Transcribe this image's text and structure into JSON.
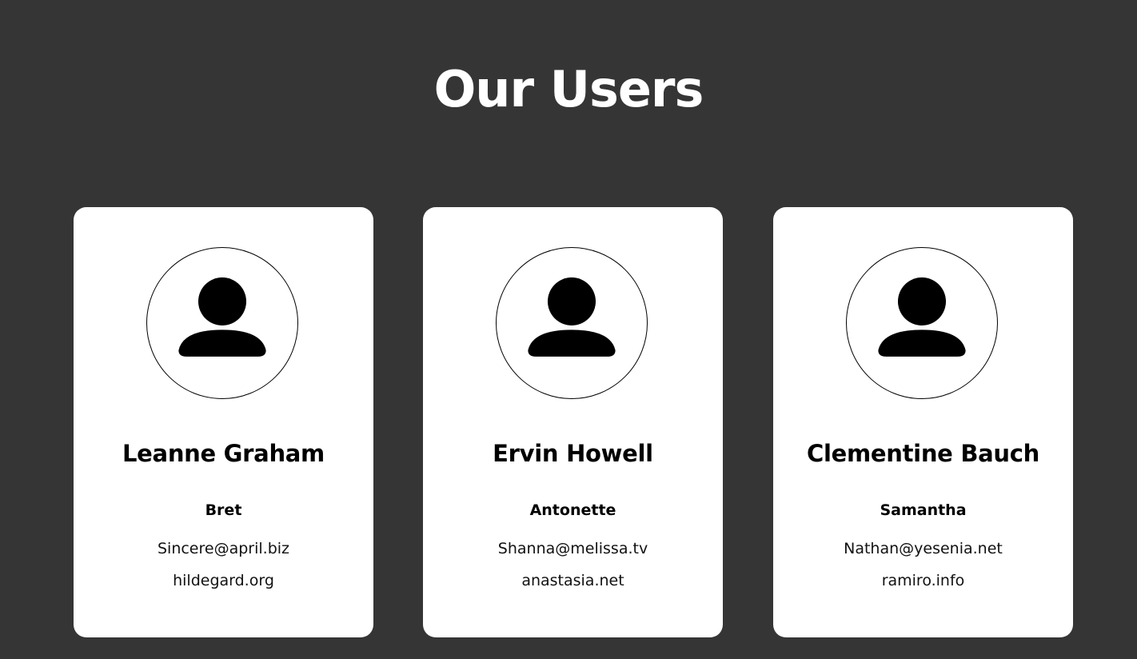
{
  "page": {
    "title": "Our Users"
  },
  "users": [
    {
      "name": "Leanne Graham",
      "username": "Bret",
      "email": "Sincere@april.biz",
      "website": "hildegard.org",
      "avatar_icon": "user-icon"
    },
    {
      "name": "Ervin Howell",
      "username": "Antonette",
      "email": "Shanna@melissa.tv",
      "website": "anastasia.net",
      "avatar_icon": "user-icon"
    },
    {
      "name": "Clementine Bauch",
      "username": "Samantha",
      "email": "Nathan@yesenia.net",
      "website": "ramiro.info",
      "avatar_icon": "user-icon"
    }
  ],
  "colors": {
    "background": "#353535",
    "card": "#ffffff",
    "title": "#ffffff",
    "text": "#000000"
  }
}
